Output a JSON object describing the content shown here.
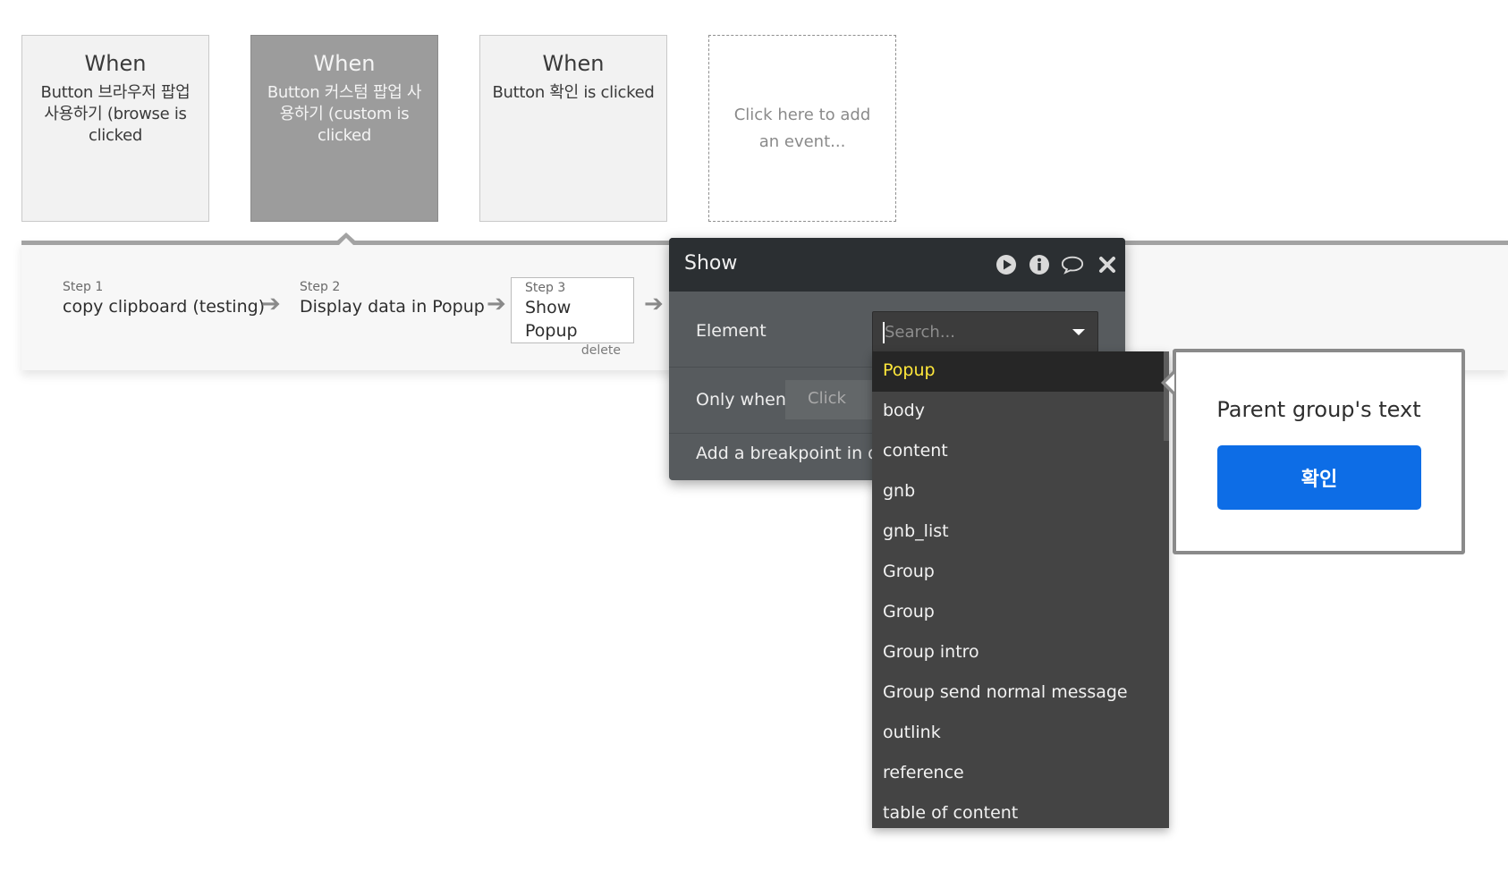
{
  "events": [
    {
      "when": "When",
      "description": "Button 브라우저 팝업 사용하기 (browse is clicked",
      "selected": false
    },
    {
      "when": "When",
      "description": "Button 커스텀 팝업 사용하기 (custom is clicked",
      "selected": true
    },
    {
      "when": "When",
      "description": "Button 확인 is clicked",
      "selected": false
    }
  ],
  "add_event_label": "Click here to add an event...",
  "steps": [
    {
      "number": "Step 1",
      "title": "copy clipboard (testing)"
    },
    {
      "number": "Step 2",
      "title": "Display data in Popup"
    },
    {
      "number": "Step 3",
      "title": "Show Popup",
      "delete_label": "delete"
    }
  ],
  "action_panel": {
    "title": "Show",
    "icons": [
      "play-icon",
      "info-icon",
      "comment-icon",
      "close-icon"
    ],
    "element_label": "Element",
    "search_placeholder": "Search...",
    "only_when_label": "Only when",
    "only_when_value": "Click",
    "breakpoint_label": "Add a breakpoint in debug mode"
  },
  "element_dropdown": {
    "options": [
      "Popup",
      "body",
      "content",
      "gnb",
      "gnb_list",
      "Group",
      "Group",
      "Group intro",
      "Group send normal message",
      "outlink",
      "reference",
      "table of content"
    ],
    "highlighted_index": 0
  },
  "popup_preview": {
    "text": "Parent group's text",
    "button_label": "확인"
  },
  "colors": {
    "panel_header": "#2b2f32",
    "panel_body": "#575b5e",
    "dropdown_bg": "#444444",
    "highlight_text": "#ffe83b",
    "primary_button": "#0d6de6"
  }
}
